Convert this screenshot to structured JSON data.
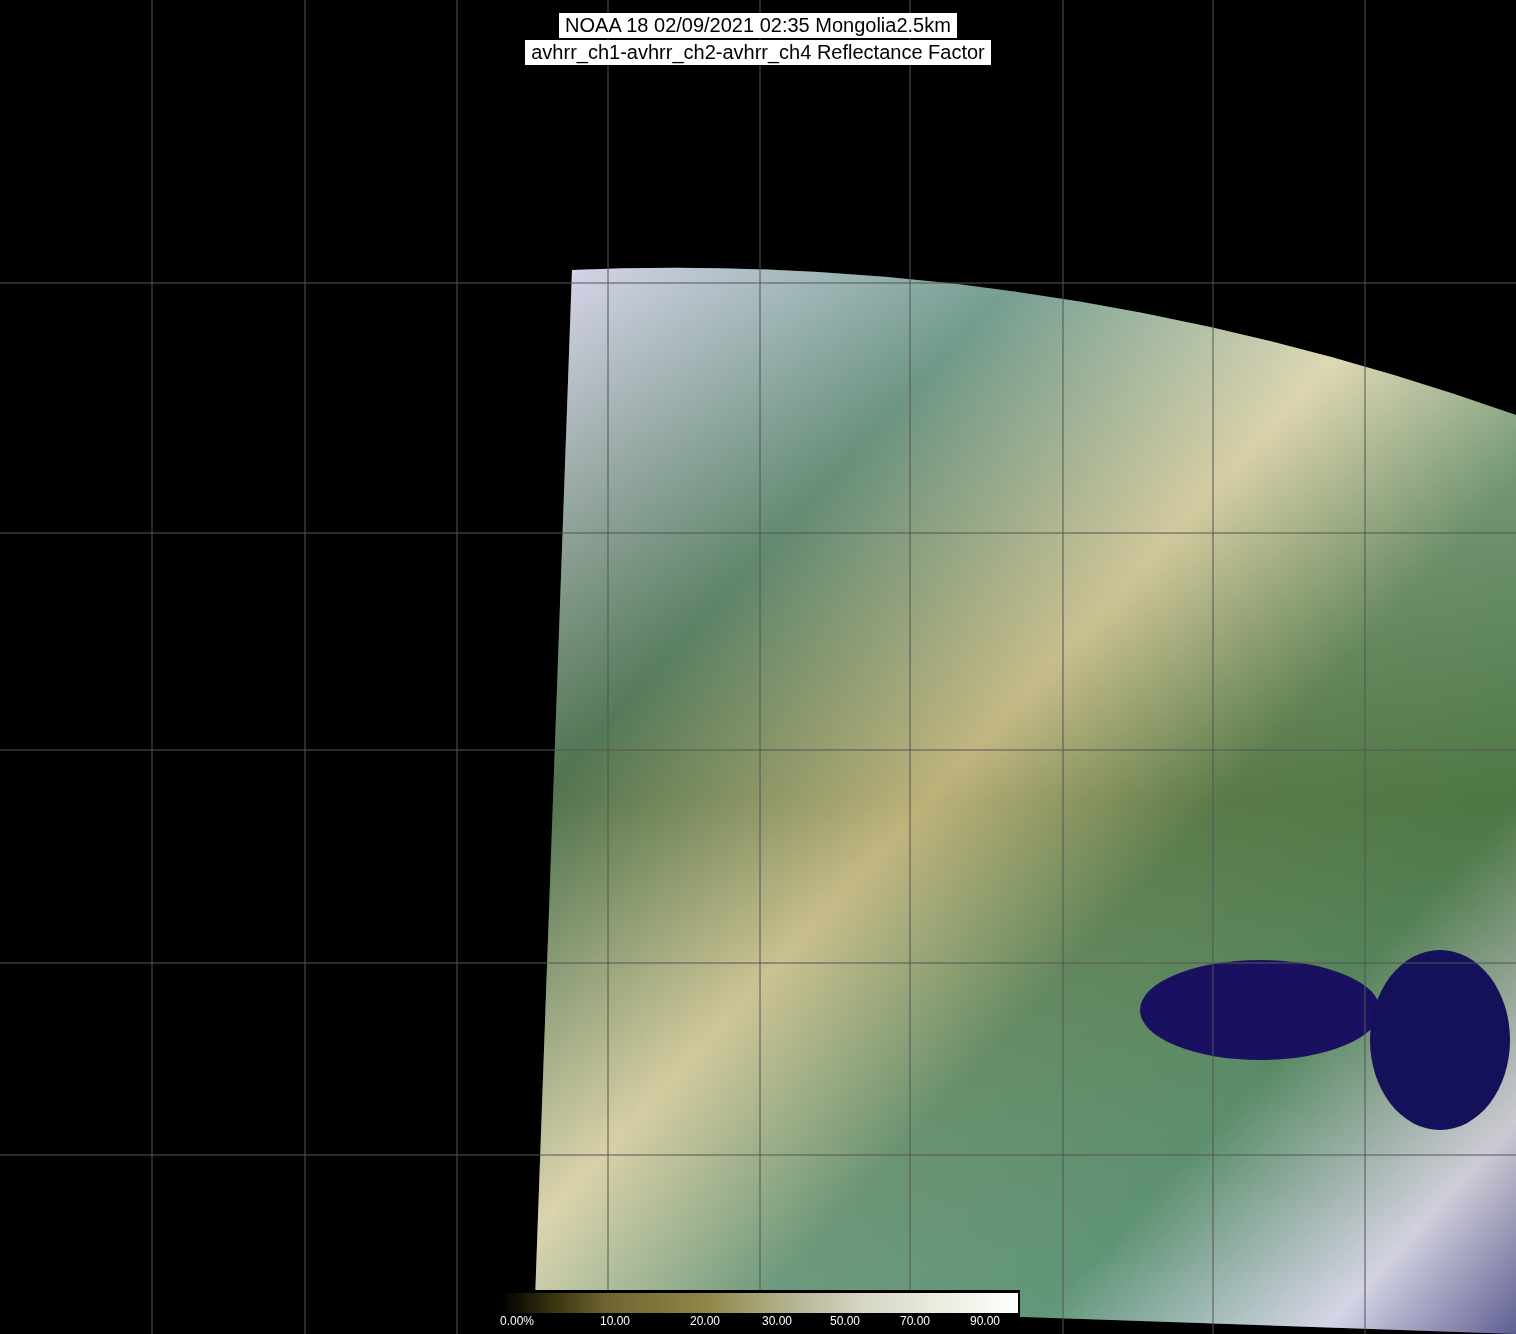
{
  "title": {
    "lines": [
      "NOAA 18 02/09/2021 02:35 Mongolia2.5km",
      "avhrr_ch1-avhrr_ch2-avhrr_ch4 Reflectance Factor"
    ]
  },
  "color_scale": {
    "labels": [
      "0.00%",
      "10.00",
      "20.00",
      "30.00",
      "50.00",
      "70.00",
      "90.00"
    ]
  }
}
